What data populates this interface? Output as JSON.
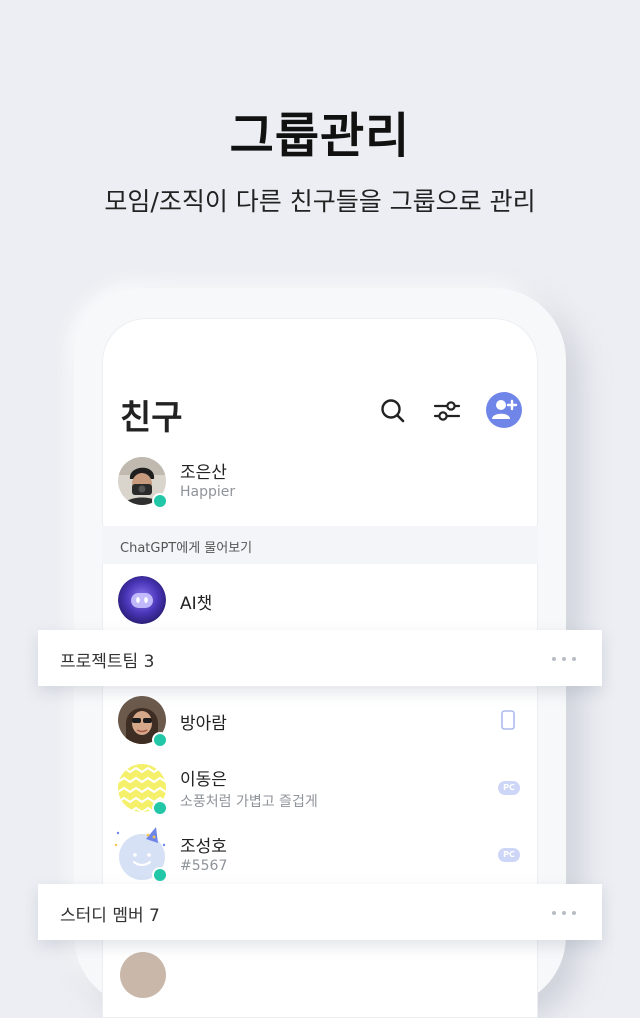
{
  "hero": {
    "title": "그룹관리",
    "subtitle": "모임/조직이 다른 친구들을 그룹으로 관리"
  },
  "app": {
    "title": "친구",
    "icons": [
      "search-icon",
      "filter-icon",
      "add-friend-icon"
    ],
    "accent": "#6f86e8",
    "online_color": "#22c7a8"
  },
  "me": {
    "name": "조은산",
    "status": "Happier"
  },
  "section": {
    "label": "ChatGPT에게 물어보기"
  },
  "ai": {
    "name": "AI챗"
  },
  "groups": [
    {
      "label": "프로젝트팀 3"
    },
    {
      "label": "스터디 멤버 7"
    }
  ],
  "friends": [
    {
      "name": "방아람",
      "status": "",
      "device": "mobile-icon"
    },
    {
      "name": "이동은",
      "status": "소풍처럼 가볍고 즐겁게",
      "device": "PC"
    },
    {
      "name": "조성호",
      "status": "#5567",
      "device": "PC"
    }
  ]
}
